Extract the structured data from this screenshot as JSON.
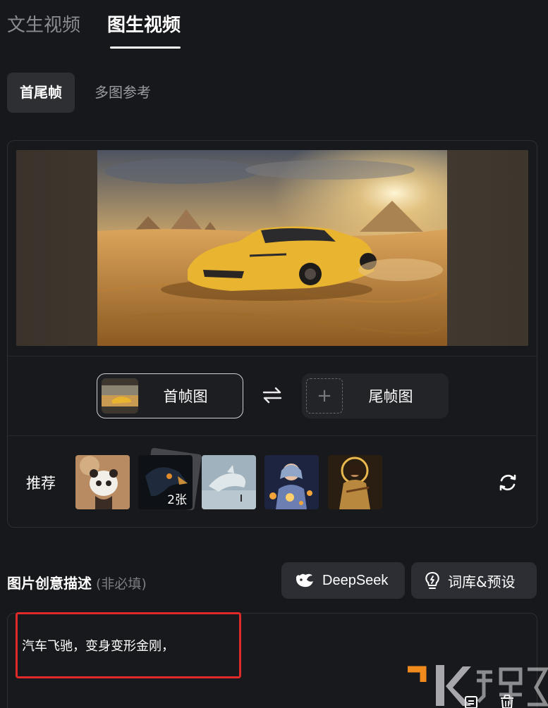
{
  "tabs": [
    {
      "label": "文生视频",
      "active": false
    },
    {
      "label": "图生视频",
      "active": true
    }
  ],
  "subtabs": [
    {
      "label": "首尾帧",
      "active": true
    },
    {
      "label": "多图参考",
      "active": false
    }
  ],
  "frames": {
    "first_label": "首帧图",
    "last_label": "尾帧图"
  },
  "recommend": {
    "label": "推荐",
    "stack_count": "2张"
  },
  "description": {
    "title": "图片创意描述",
    "optional": "(非必填)",
    "value": "汽车飞驰，变身变形金刚，"
  },
  "buttons": {
    "deepseek": "DeepSeek",
    "library": "词库&预设"
  },
  "colors": {
    "background": "#17181b",
    "card_border": "#2c2e33",
    "pill_bg": "#2c2e33",
    "highlight": "#e02a2a",
    "text": "#ffffff"
  },
  "icons": [
    "swap-icon",
    "refresh-icon",
    "deepseek-whale-icon",
    "lightbulb-icon",
    "plus-icon",
    "copy-icon",
    "trash-icon"
  ]
}
